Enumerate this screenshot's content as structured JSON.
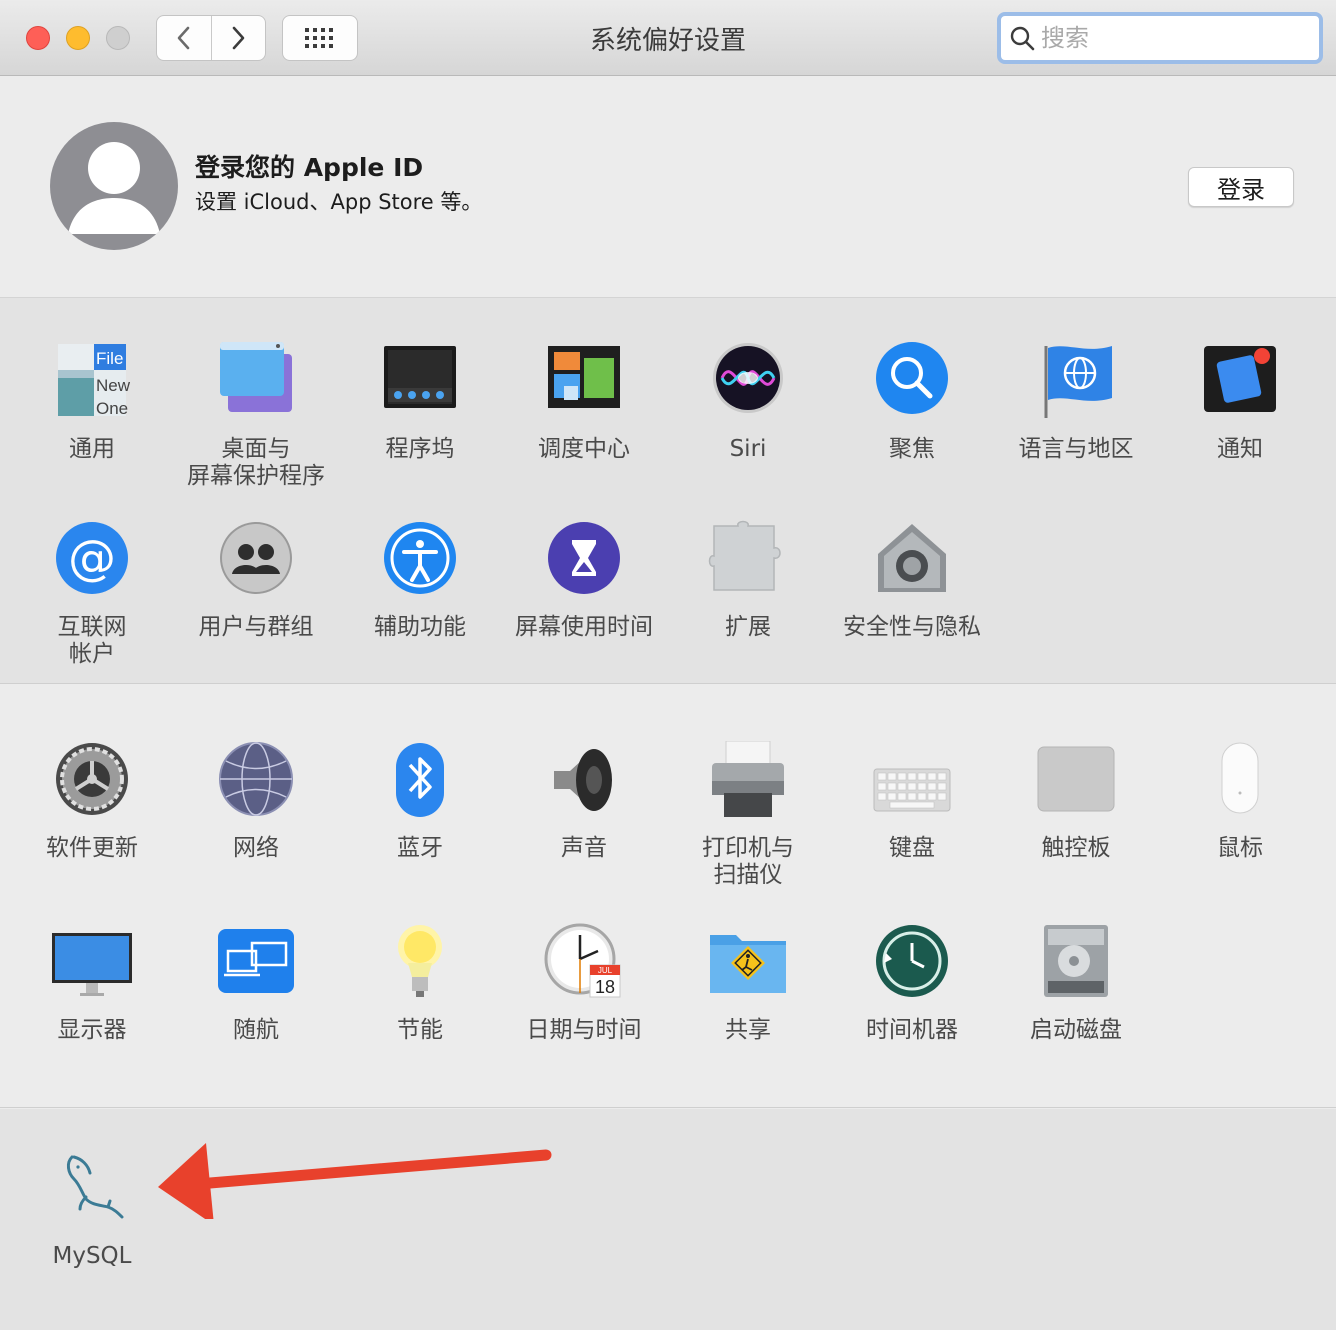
{
  "window": {
    "title": "系统偏好设置",
    "search_placeholder": "搜索"
  },
  "apple_id": {
    "title": "登录您的 Apple ID",
    "subtitle": "设置 iCloud、App Store 等。",
    "login_button": "登录"
  },
  "personal_panes": [
    {
      "label_lines": [
        "通用"
      ],
      "icon": "general-icon"
    },
    {
      "label_lines": [
        "桌面与",
        "屏幕保护程序"
      ],
      "icon": "desktop-screensaver-icon"
    },
    {
      "label_lines": [
        "程序坞"
      ],
      "icon": "dock-icon"
    },
    {
      "label_lines": [
        "调度中心"
      ],
      "icon": "mission-control-icon"
    },
    {
      "label_lines": [
        "Siri"
      ],
      "icon": "siri-icon"
    },
    {
      "label_lines": [
        "聚焦"
      ],
      "icon": "spotlight-icon"
    },
    {
      "label_lines": [
        "语言与地区"
      ],
      "icon": "language-region-icon"
    },
    {
      "label_lines": [
        "通知"
      ],
      "icon": "notifications-icon"
    },
    {
      "label_lines": [
        "互联网",
        "帐户"
      ],
      "icon": "internet-accounts-icon"
    },
    {
      "label_lines": [
        "用户与群组"
      ],
      "icon": "users-groups-icon"
    },
    {
      "label_lines": [
        "辅助功能"
      ],
      "icon": "accessibility-icon"
    },
    {
      "label_lines": [
        "屏幕使用时间"
      ],
      "icon": "screen-time-icon"
    },
    {
      "label_lines": [
        "扩展"
      ],
      "icon": "extensions-icon"
    },
    {
      "label_lines": [
        "安全性与隐私"
      ],
      "icon": "security-privacy-icon"
    }
  ],
  "hardware_panes": [
    {
      "label_lines": [
        "软件更新"
      ],
      "icon": "software-update-icon"
    },
    {
      "label_lines": [
        "网络"
      ],
      "icon": "network-icon"
    },
    {
      "label_lines": [
        "蓝牙"
      ],
      "icon": "bluetooth-icon"
    },
    {
      "label_lines": [
        "声音"
      ],
      "icon": "sound-icon"
    },
    {
      "label_lines": [
        "打印机与",
        "扫描仪"
      ],
      "icon": "printers-scanners-icon"
    },
    {
      "label_lines": [
        "键盘"
      ],
      "icon": "keyboard-icon"
    },
    {
      "label_lines": [
        "触控板"
      ],
      "icon": "trackpad-icon"
    },
    {
      "label_lines": [
        "鼠标"
      ],
      "icon": "mouse-icon"
    },
    {
      "label_lines": [
        "显示器"
      ],
      "icon": "displays-icon"
    },
    {
      "label_lines": [
        "随航"
      ],
      "icon": "sidecar-icon"
    },
    {
      "label_lines": [
        "节能"
      ],
      "icon": "energy-saver-icon"
    },
    {
      "label_lines": [
        "日期与时间"
      ],
      "icon": "date-time-icon"
    },
    {
      "label_lines": [
        "共享"
      ],
      "icon": "sharing-icon"
    },
    {
      "label_lines": [
        "时间机器"
      ],
      "icon": "time-machine-icon"
    },
    {
      "label_lines": [
        "启动磁盘"
      ],
      "icon": "startup-disk-icon"
    }
  ],
  "other_panes": [
    {
      "label_lines": [
        "MySQL"
      ],
      "icon": "mysql-dolphin-icon"
    }
  ],
  "icon_calendar": {
    "month": "JUL",
    "day": "18"
  },
  "icon_general": {
    "line1": "File",
    "line2": "New",
    "line3": "One"
  },
  "annotation": {
    "color": "#e8412c",
    "icon": "red-arrow-icon"
  }
}
